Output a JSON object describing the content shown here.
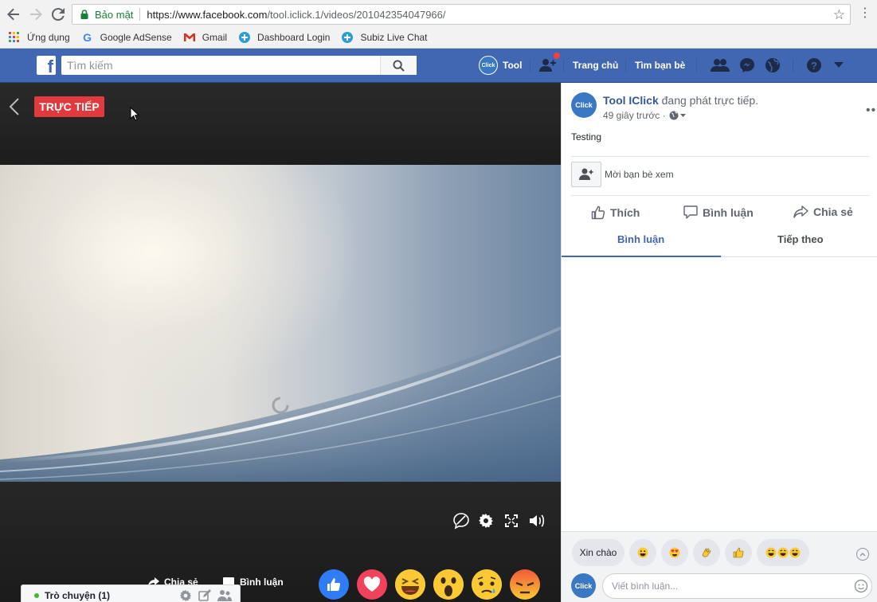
{
  "browser": {
    "secure_label": "Bảo mật",
    "url_host": "https://www.facebook.com",
    "url_path": "/tool.iclick.1/videos/201042354047966/",
    "bookmarks": [
      {
        "label": "Ứng dụng",
        "icon": "apps-grid-icon"
      },
      {
        "label": "Google AdSense",
        "icon": "google-g-icon"
      },
      {
        "label": "Gmail",
        "icon": "gmail-icon"
      },
      {
        "label": "Dashboard Login",
        "icon": "subiz-icon"
      },
      {
        "label": "Subiz Live Chat",
        "icon": "subiz-icon"
      }
    ]
  },
  "fb_nav": {
    "search_placeholder": "Tìm kiếm",
    "profile_name": "Tool",
    "avatar_text": "Click",
    "home": "Trang chủ",
    "find_friends": "Tìm bạn bè",
    "brand_color": "#4267b2"
  },
  "video": {
    "live_label": "TRỰC TIẾP",
    "share_label": "Chia sẻ",
    "comment_label": "Bình luận",
    "live_color": "#e0393e",
    "reactions": [
      "like",
      "love",
      "haha",
      "wow",
      "sad",
      "angry"
    ]
  },
  "chat": {
    "label": "Trò chuyện (1)"
  },
  "post": {
    "avatar_text": "Click",
    "author": "Tool IClick",
    "action": " đang phát trực tiếp.",
    "time": "49 giây trước ·",
    "text": "Testing",
    "invite_label": "Mời bạn bè xem",
    "like": "Thích",
    "comment": "Bình luận",
    "share": "Chia sẻ",
    "tab_comments": "Bình luận",
    "tab_next": "Tiếp theo"
  },
  "quick_replies": {
    "hello": "Xin chào"
  },
  "composer": {
    "avatar_text": "Click",
    "placeholder": "Viết bình luận..."
  }
}
